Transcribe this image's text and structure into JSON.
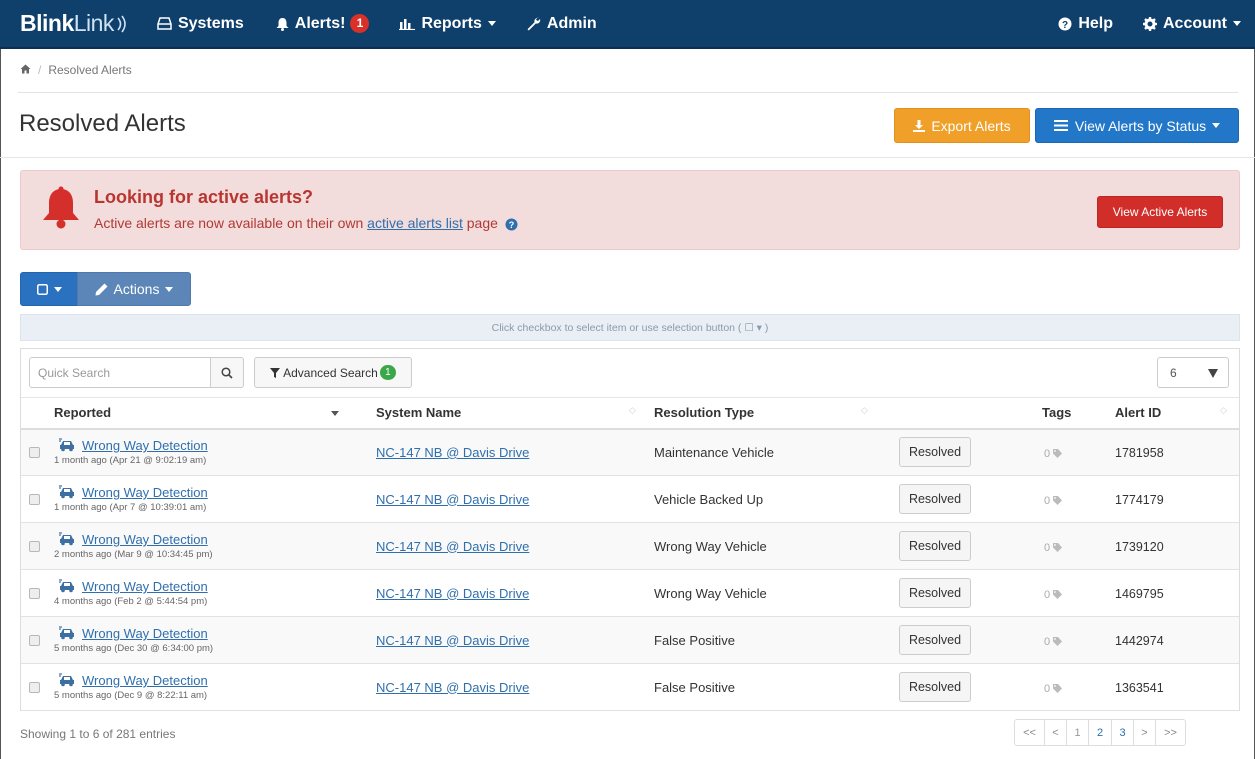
{
  "navbar": {
    "brand_bold": "Blink",
    "brand_light": "Link",
    "items": [
      {
        "label": "Systems",
        "icon": "hdd-icon"
      },
      {
        "label": "Alerts!",
        "icon": "bell-icon",
        "badge": "1"
      },
      {
        "label": "Reports",
        "icon": "bar-chart-icon"
      },
      {
        "label": "Admin",
        "icon": "wrench-icon"
      }
    ],
    "help": "Help",
    "account": "Account"
  },
  "breadcrumb": {
    "current": "Resolved Alerts"
  },
  "page": {
    "title": "Resolved Alerts",
    "export_label": "Export Alerts",
    "view_status_label": "View Alerts by Status"
  },
  "banner": {
    "heading": "Looking for active alerts?",
    "text_before": "Active alerts are now available on their own ",
    "link": "active alerts list",
    "text_after": " page",
    "button": "View Active Alerts"
  },
  "actions": {
    "actions_label": "Actions",
    "hint": "Click checkbox to select item or use selection button ( ☐ ▾ )"
  },
  "search": {
    "placeholder": "Quick Search",
    "advanced_label": "Advanced Search",
    "advanced_badge": "1",
    "page_size": "6"
  },
  "table": {
    "headers": [
      "Reported",
      "System Name",
      "Resolution Type",
      "Tags",
      "Alert ID"
    ],
    "rows": [
      {
        "type": "Wrong Way Detection",
        "time": "1 month ago (Apr 21 @ 9:02:19 am)",
        "system": "NC-147 NB @ Davis Drive",
        "resolution": "Maintenance Vehicle",
        "status": "Resolved",
        "tags": "0",
        "id": "1781958"
      },
      {
        "type": "Wrong Way Detection",
        "time": "1 month ago (Apr 7 @ 10:39:01 am)",
        "system": "NC-147 NB @ Davis Drive",
        "resolution": "Vehicle Backed Up",
        "status": "Resolved",
        "tags": "0",
        "id": "1774179"
      },
      {
        "type": "Wrong Way Detection",
        "time": "2 months ago (Mar 9 @ 10:34:45 pm)",
        "system": "NC-147 NB @ Davis Drive",
        "resolution": "Wrong Way Vehicle",
        "status": "Resolved",
        "tags": "0",
        "id": "1739120"
      },
      {
        "type": "Wrong Way Detection",
        "time": "4 months ago (Feb 2 @ 5:44:54 pm)",
        "system": "NC-147 NB @ Davis Drive",
        "resolution": "Wrong Way Vehicle",
        "status": "Resolved",
        "tags": "0",
        "id": "1469795"
      },
      {
        "type": "Wrong Way Detection",
        "time": "5 months ago (Dec 30 @ 6:34:00 pm)",
        "system": "NC-147 NB @ Davis Drive",
        "resolution": "False Positive",
        "status": "Resolved",
        "tags": "0",
        "id": "1442974"
      },
      {
        "type": "Wrong Way Detection",
        "time": "5 months ago (Dec 9 @ 8:22:11 am)",
        "system": "NC-147 NB @ Davis Drive",
        "resolution": "False Positive",
        "status": "Resolved",
        "tags": "0",
        "id": "1363541"
      }
    ]
  },
  "footer": {
    "showing": "Showing 1 to 6 of 281 entries",
    "pager": [
      "<<",
      "<",
      "1",
      "2",
      "3",
      ">",
      ">>"
    ]
  },
  "colors": {
    "navbar": "#0f3f6b",
    "export": "#f0a028",
    "status": "#2277c9",
    "danger": "#d12e2a",
    "link": "#2f6fad"
  }
}
